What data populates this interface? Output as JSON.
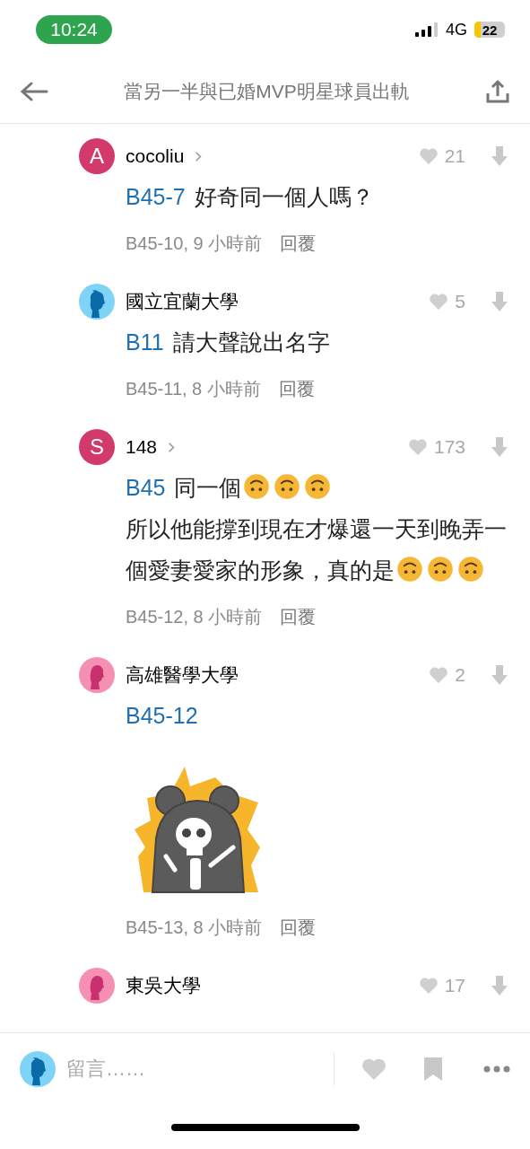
{
  "status_bar": {
    "time": "10:24",
    "network": "4G",
    "battery": "22"
  },
  "header": {
    "title": "當另一半與已婚MVP明星球員出軌"
  },
  "comments": [
    {
      "avatar": {
        "kind": "letter",
        "letter": "A",
        "color": "#d23a6b"
      },
      "name": "cocoliu",
      "chevron": true,
      "likes": "21",
      "body": [
        {
          "kind": "tag",
          "text": "B45-7"
        },
        {
          "kind": "text",
          "text": "好奇同一個人嗎？"
        }
      ],
      "meta": "B45-10, 9 小時前",
      "reply": "回覆"
    },
    {
      "avatar": {
        "kind": "boy",
        "color": "#7fd3f7"
      },
      "name": "國立宜蘭大學",
      "likes": "5",
      "body": [
        {
          "kind": "tag",
          "text": "B11"
        },
        {
          "kind": "text",
          "text": "請大聲說出名字"
        }
      ],
      "meta": "B45-11, 8 小時前",
      "reply": "回覆"
    },
    {
      "avatar": {
        "kind": "letter",
        "letter": "S",
        "color": "#d23a6b"
      },
      "name": "148",
      "chevron": true,
      "likes": "173",
      "body": [
        {
          "kind": "tag",
          "text": "B45"
        },
        {
          "kind": "text",
          "text": "同一個"
        },
        {
          "kind": "emoji"
        },
        {
          "kind": "emoji"
        },
        {
          "kind": "emoji"
        },
        {
          "kind": "break"
        },
        {
          "kind": "text",
          "text": "所以他能撐到現在才爆還一天到晚弄一個愛妻愛家的形象，真的是"
        },
        {
          "kind": "emoji"
        },
        {
          "kind": "emoji"
        },
        {
          "kind": "emoji"
        }
      ],
      "meta": "B45-12, 8 小時前",
      "reply": "回覆"
    },
    {
      "avatar": {
        "kind": "girl",
        "color": "#f590b3"
      },
      "name": "高雄醫學大學",
      "likes": "2",
      "body": [
        {
          "kind": "tag",
          "text": "B45-12"
        }
      ],
      "sticker": true,
      "meta": "B45-13, 8 小時前",
      "reply": "回覆"
    },
    {
      "avatar": {
        "kind": "girl",
        "color": "#f590b3"
      },
      "name": "東吳大學",
      "likes": "17"
    }
  ],
  "composer": {
    "avatar": {
      "kind": "boy",
      "color": "#7fd3f7"
    },
    "placeholder": "留言……"
  }
}
